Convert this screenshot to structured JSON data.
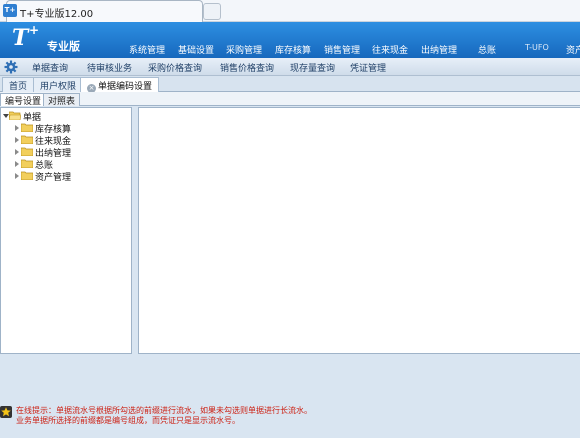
{
  "window": {
    "app_icon_text": "T+",
    "title": "T+专业版12.00"
  },
  "header": {
    "logo_letter": "T",
    "logo_plus": "+",
    "edition": "专业版",
    "menu": [
      {
        "label": "系统管理"
      },
      {
        "label": "基础设置"
      },
      {
        "label": "采购管理"
      },
      {
        "label": "库存核算"
      },
      {
        "label": "销售管理"
      },
      {
        "label": "往来现金"
      },
      {
        "label": "出纳管理"
      },
      {
        "label": "总账"
      }
    ],
    "user_label": "T-UFO",
    "assets_label": "资产"
  },
  "subbar": {
    "items": [
      {
        "label": "单据查询"
      },
      {
        "label": "待审核业务"
      },
      {
        "label": "采购价格查询"
      },
      {
        "label": "销售价格查询"
      },
      {
        "label": "现存量查询"
      },
      {
        "label": "凭证管理"
      }
    ]
  },
  "doc_tabs": [
    {
      "label": "首页"
    },
    {
      "label": "用户权限"
    },
    {
      "label": "单据编码设置"
    }
  ],
  "inner_tabs": [
    {
      "label": "编号设置"
    },
    {
      "label": "对照表"
    }
  ],
  "tree": {
    "root": "单据",
    "children": [
      {
        "label": "库存核算"
      },
      {
        "label": "往来现金"
      },
      {
        "label": "出纳管理"
      },
      {
        "label": "总账"
      },
      {
        "label": "资产管理"
      }
    ]
  },
  "tips": {
    "line1": "在线提示：单据流水号根据所勾选的前缀进行流水，如果未勾选则单据进行长流水。",
    "line2": "业务单据所选择的前缀都是编号组成，而凭证只是显示流水号。"
  },
  "colors": {
    "header_blue": "#1f7cd3",
    "tip_red": "#cc1f12",
    "folder_yellow": "#f2cf5c"
  }
}
